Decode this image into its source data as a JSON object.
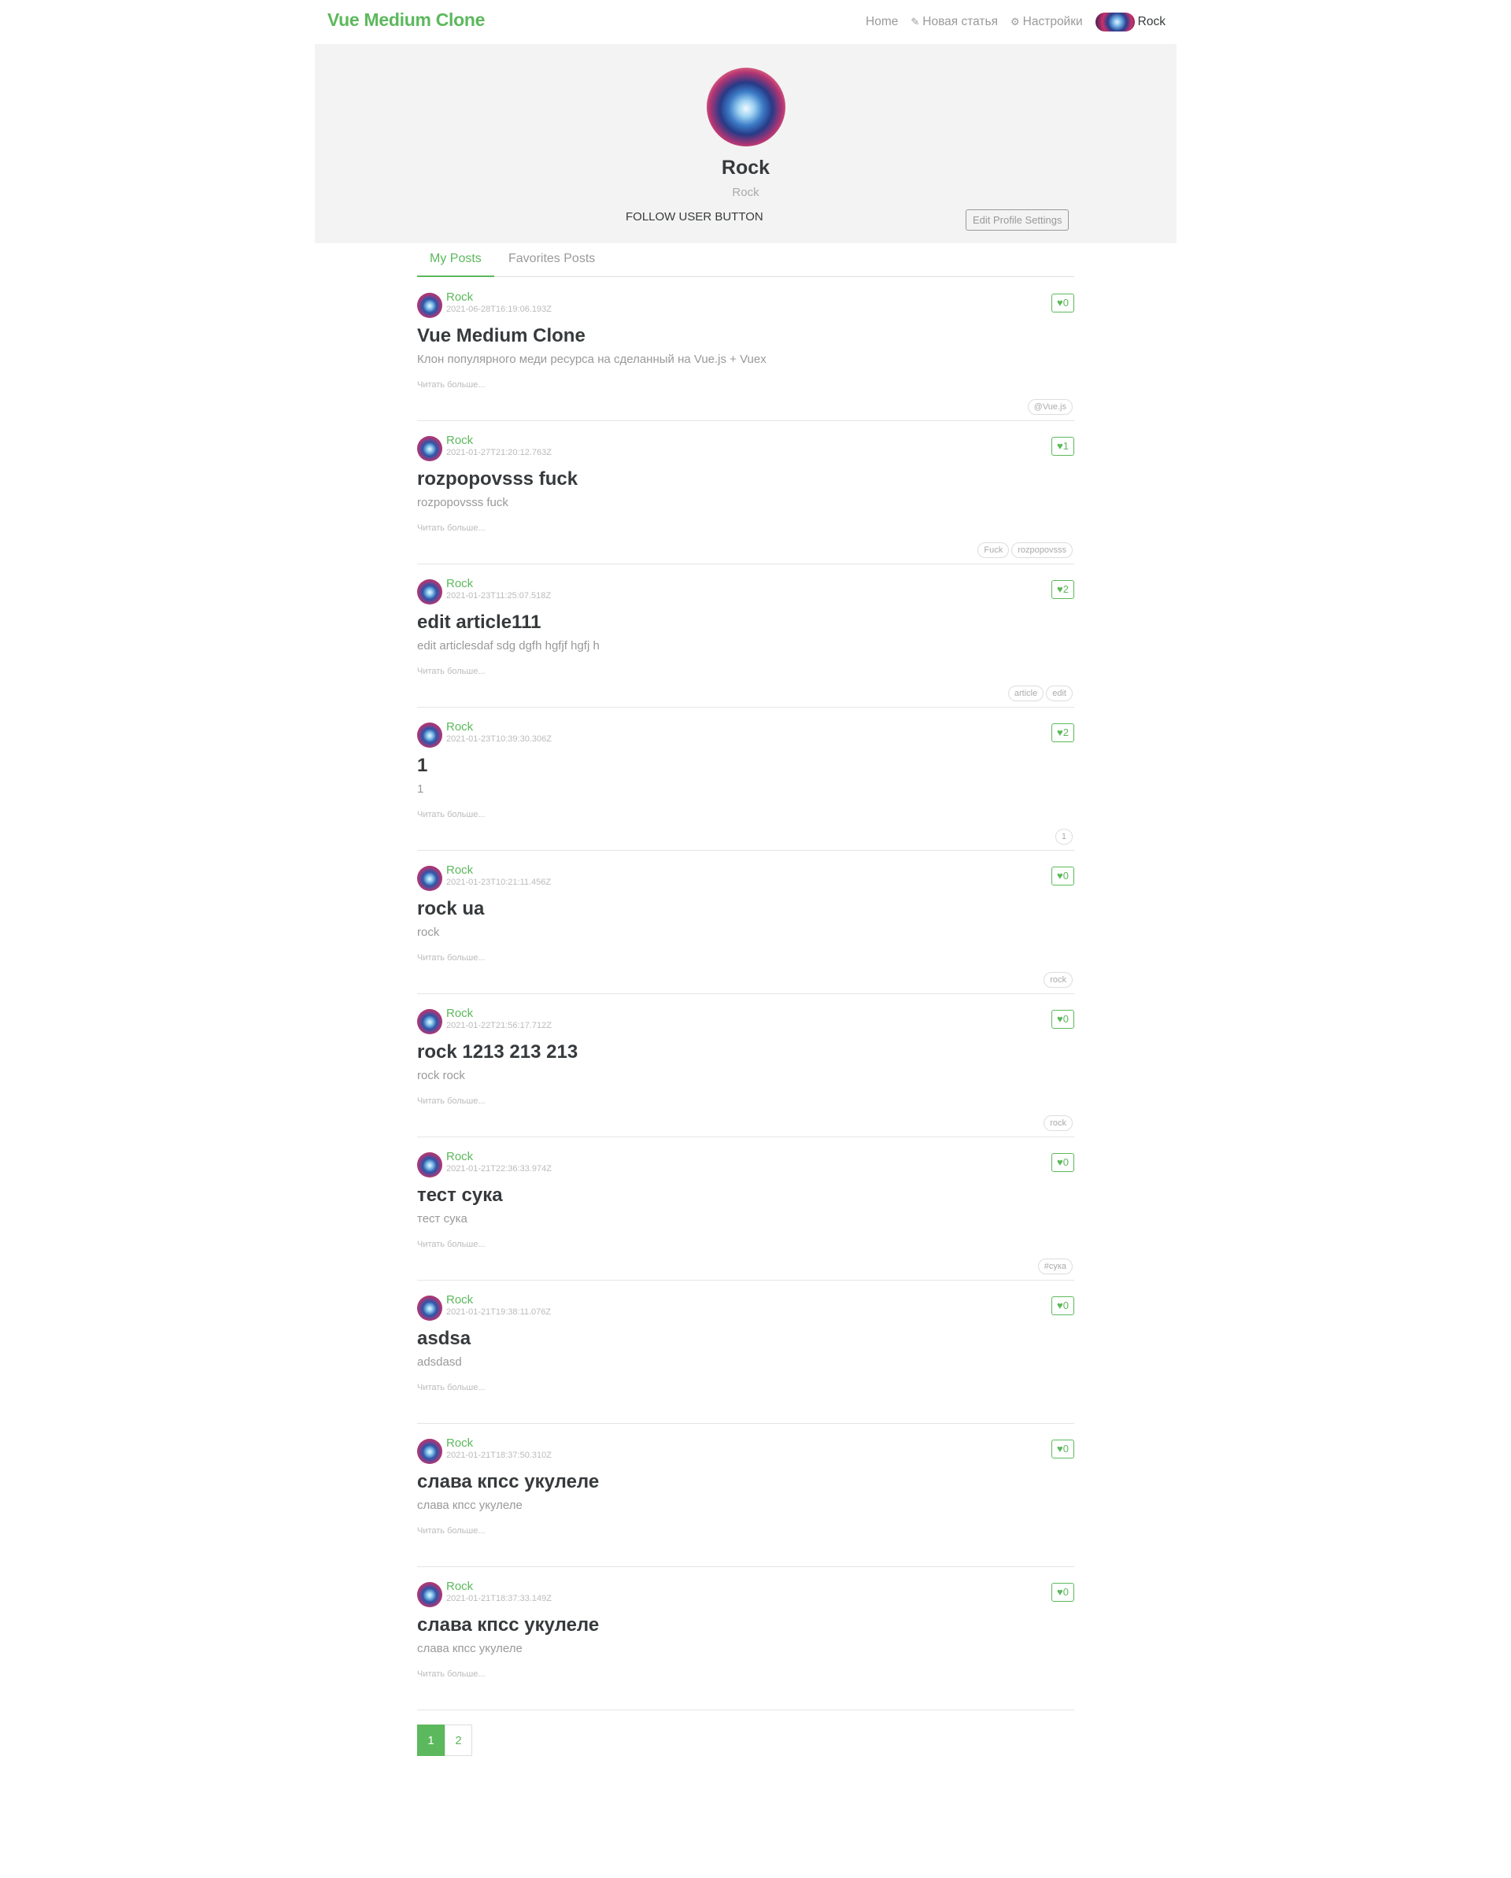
{
  "navbar": {
    "brand": "Vue Medium Clone",
    "links": [
      {
        "label": "Home",
        "icon": ""
      },
      {
        "label": "Новая статья",
        "icon": "edit-icon"
      },
      {
        "label": "Настройки",
        "icon": "gear-icon"
      }
    ],
    "user": "Rock"
  },
  "profile": {
    "username": "Rock",
    "bio": "Rock",
    "follow_label": "FOLLOW USER BUTTON",
    "edit_label": "Edit Profile Settings"
  },
  "tabs": {
    "my_posts": "My Posts",
    "favorites": "Favorites Posts"
  },
  "read_more": "Читать больше...",
  "articles": [
    {
      "author": "Rock",
      "date": "2021-06-28T16:19:06.193Z",
      "likes": "0",
      "title": "Vue Medium Clone",
      "description": "Клон популярного меди ресурса на сделанный на Vue.js + Vuex",
      "tags": [
        "@Vue.js"
      ]
    },
    {
      "author": "Rock",
      "date": "2021-01-27T21:20:12.763Z",
      "likes": "1",
      "title": "rozpopovsss fuck",
      "description": "rozpopovsss fuck",
      "tags": [
        "Fuck",
        "rozpopovsss"
      ]
    },
    {
      "author": "Rock",
      "date": "2021-01-23T11:25:07.518Z",
      "likes": "2",
      "title": "edit article111",
      "description": "edit articlesdaf sdg dgfh hgfjf hgfj h",
      "tags": [
        "article",
        "edit"
      ]
    },
    {
      "author": "Rock",
      "date": "2021-01-23T10:39:30.306Z",
      "likes": "2",
      "title": "1",
      "description": "1",
      "tags": [
        "1"
      ]
    },
    {
      "author": "Rock",
      "date": "2021-01-23T10:21:11.456Z",
      "likes": "0",
      "title": "rock ua",
      "description": "rock",
      "tags": [
        "rock"
      ]
    },
    {
      "author": "Rock",
      "date": "2021-01-22T21:56:17.712Z",
      "likes": "0",
      "title": "rock 1213 213 213",
      "description": "rock rock",
      "tags": [
        "rock"
      ]
    },
    {
      "author": "Rock",
      "date": "2021-01-21T22:36:33.974Z",
      "likes": "0",
      "title": "тест сука",
      "description": "тест сука",
      "tags": [
        "#сука"
      ]
    },
    {
      "author": "Rock",
      "date": "2021-01-21T19:38:11.076Z",
      "likes": "0",
      "title": "asdsa",
      "description": "adsdasd",
      "tags": []
    },
    {
      "author": "Rock",
      "date": "2021-01-21T18:37:50.310Z",
      "likes": "0",
      "title": "слава кпсс укулеле",
      "description": "слава кпсс укулеле",
      "tags": []
    },
    {
      "author": "Rock",
      "date": "2021-01-21T18:37:33.149Z",
      "likes": "0",
      "title": "слава кпсс укулеле",
      "description": "слава кпсс укулеле",
      "tags": []
    }
  ],
  "pagination": {
    "pages": [
      "1",
      "2"
    ],
    "current": "1"
  }
}
